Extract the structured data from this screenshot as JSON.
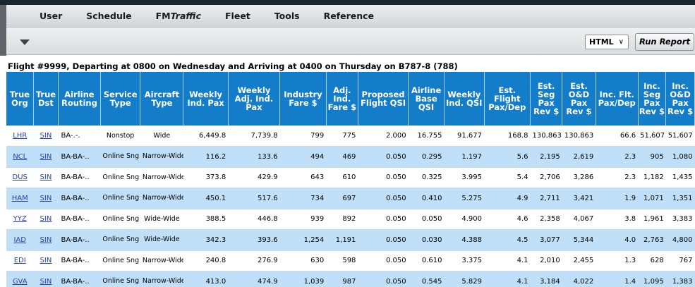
{
  "menu": [
    "User",
    "Schedule",
    "FM",
    "Fleet",
    "Tools",
    "Reference"
  ],
  "menu_fm_suffix": "Traffic",
  "toolbar": {
    "format": "HTML",
    "run_label": "Run Report"
  },
  "report_title": "Flight #9999, Departing at 0800 on Wednesday and Arriving at 0400 on Thursday on B787-8 (788)",
  "columns": [
    "True Org",
    "True Dst",
    "Airline Routing",
    "Service Type",
    "Aircraft Type",
    "Weekly Ind. Pax",
    "Weekly Adj. Ind. Pax",
    "Industry Fare $",
    "Adj. Ind. Fare $",
    "Proposed Flight QSI",
    "Airline Base QSI",
    "Weekly Ind. QSI",
    "Est. Flight Pax/Dep",
    "Est. Seg Pax Rev $",
    "Est. O&D Pax Rev $",
    "Inc. Flt. Pax/Dep",
    "Inc. Seg Pax Rev $",
    "Inc. O&D Pax Rev $"
  ],
  "rows": [
    [
      "LHR",
      "SIN",
      "BA-.-.",
      "Nonstop",
      "Wide",
      "6,449.8",
      "7,739.8",
      "799",
      "775",
      "2.000",
      "16.755",
      "91.677",
      "168.8",
      "130,863",
      "130,863",
      "66.6",
      "51,607",
      "51,607"
    ],
    [
      "NCL",
      "SIN",
      "BA-BA-..",
      "Online Sng",
      "Narrow-Wide",
      "116.2",
      "133.6",
      "494",
      "469",
      "0.050",
      "0.295",
      "1.197",
      "5.6",
      "2,195",
      "2,619",
      "2.3",
      "905",
      "1,080"
    ],
    [
      "DUS",
      "SIN",
      "BA-BA-..",
      "Online Sng",
      "Narrow-Wide",
      "373.8",
      "429.9",
      "643",
      "610",
      "0.050",
      "0.325",
      "3.995",
      "5.4",
      "2,706",
      "3,286",
      "2.3",
      "1,182",
      "1,435"
    ],
    [
      "HAM",
      "SIN",
      "BA-BA-..",
      "Online Sng",
      "Narrow-Wide",
      "450.1",
      "517.6",
      "734",
      "697",
      "0.050",
      "0.410",
      "5.275",
      "4.9",
      "2,711",
      "3,421",
      "1.9",
      "1,071",
      "1,351"
    ],
    [
      "YYZ",
      "SIN",
      "BA-BA-..",
      "Online Sng",
      "Wide-Wide",
      "388.5",
      "446.8",
      "939",
      "892",
      "0.050",
      "0.050",
      "4.900",
      "4.6",
      "2,358",
      "4,067",
      "3.8",
      "1,961",
      "3,383"
    ],
    [
      "IAD",
      "SIN",
      "BA-BA-..",
      "Online Sng",
      "Wide-Wide",
      "342.3",
      "393.6",
      "1,254",
      "1,191",
      "0.050",
      "0.030",
      "4.388",
      "4.5",
      "3,077",
      "5,344",
      "4.0",
      "2,763",
      "4,800"
    ],
    [
      "EDI",
      "SIN",
      "BA-BA-..",
      "Online Sng",
      "Narrow-Wide",
      "240.8",
      "276.9",
      "630",
      "598",
      "0.050",
      "0.610",
      "3.375",
      "4.1",
      "2,010",
      "2,455",
      "1.3",
      "628",
      "767"
    ],
    [
      "GVA",
      "SIN",
      "BA-BA-..",
      "Online Sng",
      "Narrow-Wide",
      "413.0",
      "474.9",
      "1,039",
      "987",
      "0.050",
      "0.545",
      "5.829",
      "4.1",
      "3,184",
      "4,022",
      "1.4",
      "1,095",
      "1,383"
    ]
  ]
}
